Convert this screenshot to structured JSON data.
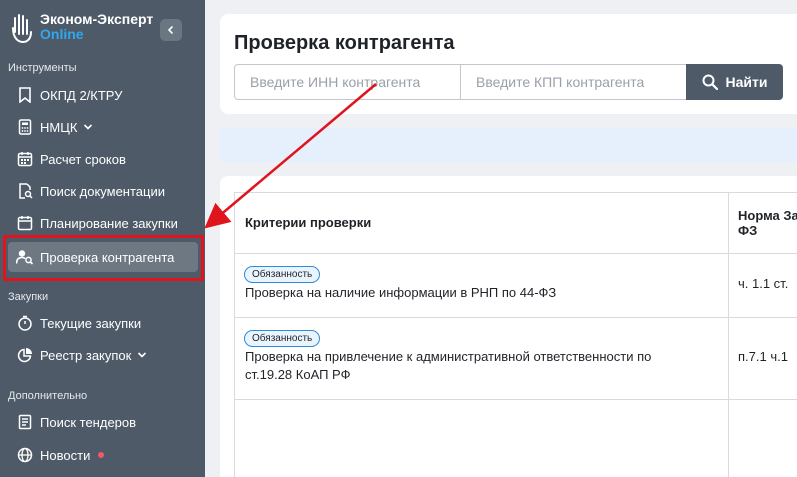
{
  "brand": {
    "name": "Эконом-Эксперт",
    "sub": "Online"
  },
  "sidebar": {
    "sections": [
      {
        "title": "Инструменты"
      },
      {
        "title": "Закупки"
      },
      {
        "title": "Дополнительно"
      }
    ],
    "items": [
      {
        "label": "ОКПД 2/КТРУ",
        "icon": "bookmark-icon"
      },
      {
        "label": "НМЦК",
        "icon": "calculator-icon",
        "has_dropdown": true
      },
      {
        "label": "Расчет сроков",
        "icon": "calendar-icon"
      },
      {
        "label": "Поиск документации",
        "icon": "document-search-icon"
      },
      {
        "label": "Планирование закупки",
        "icon": "calendar-plan-icon"
      },
      {
        "label": "Проверка контрагента",
        "icon": "user-search-icon",
        "active": true
      },
      {
        "label": "Текущие закупки",
        "icon": "stopwatch-icon"
      },
      {
        "label": "Реестр закупок",
        "icon": "pie-chart-icon",
        "has_dropdown": true
      },
      {
        "label": "Поиск тендеров",
        "icon": "document-list-icon"
      },
      {
        "label": "Новости",
        "icon": "globe-icon",
        "has_notification": true
      }
    ]
  },
  "main": {
    "title": "Проверка контрагента",
    "inn_placeholder": "Введите ИНН контрагента",
    "kpp_placeholder": "Введите КПП контрагента",
    "search_label": "Найти"
  },
  "table": {
    "headers": [
      "Критерии проверки",
      "Норма За",
      "ФЗ"
    ],
    "rows": [
      {
        "badge": "Обязанность",
        "criterion": "Проверка на наличие информации в РНП по 44-ФЗ",
        "norm": "ч. 1.1 ст."
      },
      {
        "badge": "Обязанность",
        "criterion_line1": "Проверка на привлечение к административной ответственности по",
        "criterion_line2": "ст.19.28 КоАП РФ",
        "norm": "п.7.1 ч.1"
      }
    ]
  },
  "colors": {
    "sidebar": "#4e5a68",
    "accent": "#2fa8f0",
    "highlight": "#e0141c",
    "badge_border": "#2f8bd8"
  }
}
